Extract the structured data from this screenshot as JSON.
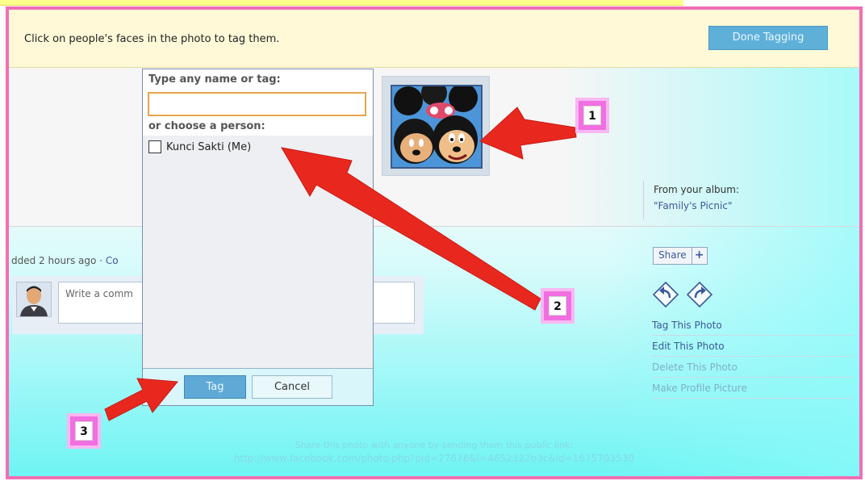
{
  "banner": {
    "instruction": "Click on people's faces in the photo to tag them.",
    "done_button": "Done Tagging"
  },
  "album": {
    "label": "From your album:",
    "name": "\"Family's Picnic\""
  },
  "post": {
    "added_prefix": "dded 2 hours ago ·",
    "added_link": "Co",
    "comment_placeholder": "Write a comm"
  },
  "actions": {
    "share_label": "Share",
    "share_plus": "+",
    "links": [
      "Tag This Photo",
      "Edit This Photo",
      "Delete This Photo",
      "Make Profile Picture"
    ]
  },
  "share_link": {
    "note": "Share this photo with anyone by sending them this public link:",
    "url": "http://www.facebook.com/photo.php?pid=27676&l=4652322b3c&id=1675703530"
  },
  "tag_popup": {
    "title": "Type any name or tag:",
    "input_value": "",
    "subtitle": "or choose a person:",
    "person": "Kunci Sakti (Me)",
    "tag_button": "Tag",
    "cancel_button": "Cancel"
  },
  "callouts": [
    "1",
    "2",
    "3"
  ],
  "colors": {
    "frame": "#ef6fb4",
    "callout": "#f16fe1",
    "arrow": "#e8281f",
    "link": "#3b5998",
    "button": "#5fa9d7"
  }
}
